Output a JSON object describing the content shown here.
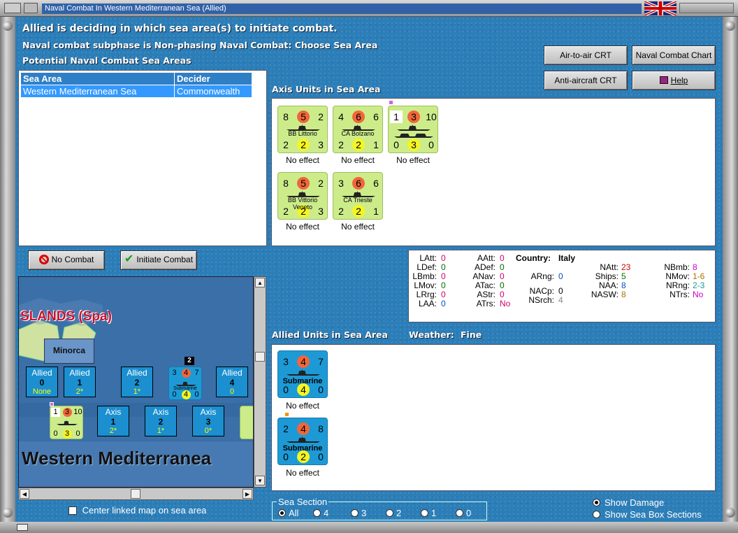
{
  "window": {
    "title": "Naval Combat In Western Mediterranean Sea (Allied)"
  },
  "status": {
    "line1": "Allied is deciding in which sea area(s) to initiate combat.",
    "line2": "Naval combat subphase is Non-phasing Naval Combat: Choose Sea Area",
    "line3": "Potential Naval Combat Sea Areas"
  },
  "buttons": {
    "air_to_air": "Air-to-air CRT",
    "naval_chart": "Naval Combat Chart",
    "anti_aircraft": "Anti-aircraft CRT",
    "help": "Help",
    "no_combat": "No Combat",
    "initiate": "Initiate Combat"
  },
  "sea_table": {
    "headers": [
      "Sea Area",
      "Decider"
    ],
    "rows": [
      [
        "Western Mediterranean Sea",
        "Commonwealth"
      ]
    ]
  },
  "axis": {
    "title": "Axis Units in Sea Area",
    "units": [
      {
        "tl": "8",
        "tc": "5",
        "tr": "2",
        "name": "BB Littorio",
        "bl": "2",
        "bc": "2",
        "br": "3",
        "effect": "No effect"
      },
      {
        "tl": "4",
        "tc": "6",
        "tr": "6",
        "name": "CA Bolzano",
        "bl": "2",
        "bc": "2",
        "br": "1",
        "effect": "No effect"
      },
      {
        "tl": "1",
        "tc": "3",
        "tr": "10",
        "name": "",
        "bl": "0",
        "bc": "3",
        "br": "0",
        "effect": "No effect"
      },
      {
        "tl": "8",
        "tc": "5",
        "tr": "2",
        "name": "BB Vittorio Veneto",
        "bl": "2",
        "bc": "2",
        "br": "3",
        "effect": "No effect"
      },
      {
        "tl": "3",
        "tc": "6",
        "tr": "6",
        "name": "CA Trieste",
        "bl": "2",
        "bc": "2",
        "br": "1",
        "effect": "No effect"
      }
    ]
  },
  "stats": {
    "country_label": "Country:",
    "country": "Italy",
    "col1": [
      [
        "LAtt:",
        "0"
      ],
      [
        "LDef:",
        "0"
      ],
      [
        "LBmb:",
        "0"
      ],
      [
        "LMov:",
        "0"
      ],
      [
        "LRrg:",
        "0"
      ],
      [
        "LAA:",
        "0"
      ]
    ],
    "col2": [
      [
        "AAtt:",
        "0"
      ],
      [
        "ADef:",
        "0"
      ],
      [
        "ANav:",
        "0"
      ],
      [
        "ATac:",
        "0"
      ],
      [
        "AStr:",
        "0"
      ],
      [
        "ATrs:",
        "No"
      ]
    ],
    "col3": [
      [
        "ARng:",
        "0"
      ],
      [
        "NACp:",
        "0"
      ],
      [
        "NSrch:",
        "4"
      ]
    ],
    "col4": [
      [
        "NAtt:",
        "23"
      ],
      [
        "Ships:",
        "5"
      ],
      [
        "NAA:",
        "8"
      ],
      [
        "NASW:",
        "8"
      ]
    ],
    "col5": [
      [
        "NBmb:",
        "8"
      ],
      [
        "NMov:",
        "1-6"
      ],
      [
        "NRng:",
        "2-3"
      ],
      [
        "NTrs:",
        "No"
      ]
    ]
  },
  "allied": {
    "title": "Allied Units in Sea Area",
    "weather_label": "Weather:",
    "weather": "Fine",
    "units": [
      {
        "tl": "3",
        "tc": "4",
        "tr": "7",
        "name": "Submarine",
        "bl": "0",
        "bc": "4",
        "br": "0",
        "effect": "No effect"
      },
      {
        "tl": "2",
        "tc": "4",
        "tr": "8",
        "name": "Submarine",
        "bl": "0",
        "bc": "2",
        "br": "0",
        "effect": "No effect"
      }
    ]
  },
  "map": {
    "region": "SLANDS (Spa)",
    "island": "Minorca",
    "sea_name": "Western Mediterranea",
    "allied_boxes": [
      {
        "h": "Allied",
        "v": "0",
        "s": "None"
      },
      {
        "h": "Allied",
        "v": "1",
        "s": "2*"
      },
      {
        "h": "Allied",
        "v": "2",
        "s": "1*"
      },
      {
        "h": "Allied",
        "v": "4",
        "s": "0"
      }
    ],
    "axis_boxes": [
      {
        "h": "Axis",
        "v": "1",
        "s": "2*"
      },
      {
        "h": "Axis",
        "v": "2",
        "s": "1*"
      },
      {
        "h": "Axis",
        "v": "3",
        "s": "0*"
      }
    ],
    "stack_count": "2",
    "mini_sub": {
      "tl": "3",
      "tc": "4",
      "tr": "7",
      "name": "Submarine",
      "bl": "0",
      "bc": "4",
      "br": "0"
    },
    "mini_axis": {
      "tl": "1",
      "tc": "3",
      "tr": "10",
      "bl": "0",
      "bc": "3",
      "br": "0"
    },
    "center_label": "Center linked map on sea area"
  },
  "sea_section": {
    "label": "Sea Section",
    "options": [
      "All",
      "4",
      "3",
      "2",
      "1",
      "0"
    ],
    "selected": "All"
  },
  "display": {
    "options": [
      "Show Damage",
      "Show Sea Box Sections"
    ],
    "selected": "Show Damage"
  },
  "colors": {
    "zero": "#d4006e",
    "green": "#006e00",
    "blue": "#0050c8",
    "orange": "#b07000",
    "red": "#d40000"
  }
}
